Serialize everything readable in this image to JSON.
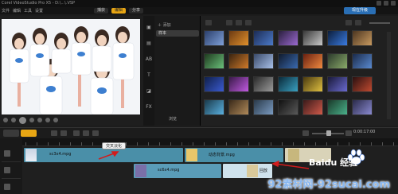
{
  "window": {
    "title": "Corel VideoStudio Pro X5 - D:\\...\\.VSP"
  },
  "menu": {
    "items": [
      "文件",
      "编辑",
      "工具",
      "设置"
    ],
    "steps": [
      {
        "label": "捕获",
        "active": false
      },
      {
        "label": "编辑",
        "active": true
      },
      {
        "label": "分享",
        "active": false
      }
    ],
    "upgrade_label": "现在升级"
  },
  "library": {
    "add_label": "添加",
    "selected_folder": "样本",
    "browse_label": "浏览"
  },
  "timeline": {
    "timecode": "0:00:17:00",
    "tooltip": "交叉淡化",
    "clips": [
      {
        "label": "sc3x4.mpg",
        "track": "video"
      },
      {
        "label": "动态背景.mpg",
        "track": "video"
      },
      {
        "label": "sc6x4.mpg",
        "track": "overlay"
      },
      {
        "label": "回放",
        "track": "overlay"
      }
    ]
  },
  "watermark": {
    "site_text": "92素材网-92sucai.com",
    "logo_text": "Baidu 经验"
  },
  "colors": {
    "accent": "#e8a614",
    "clip_video": "#4a8fa8",
    "clip_overlay": "#5a9cb8",
    "annotation_arrow": "#d21c1c"
  }
}
